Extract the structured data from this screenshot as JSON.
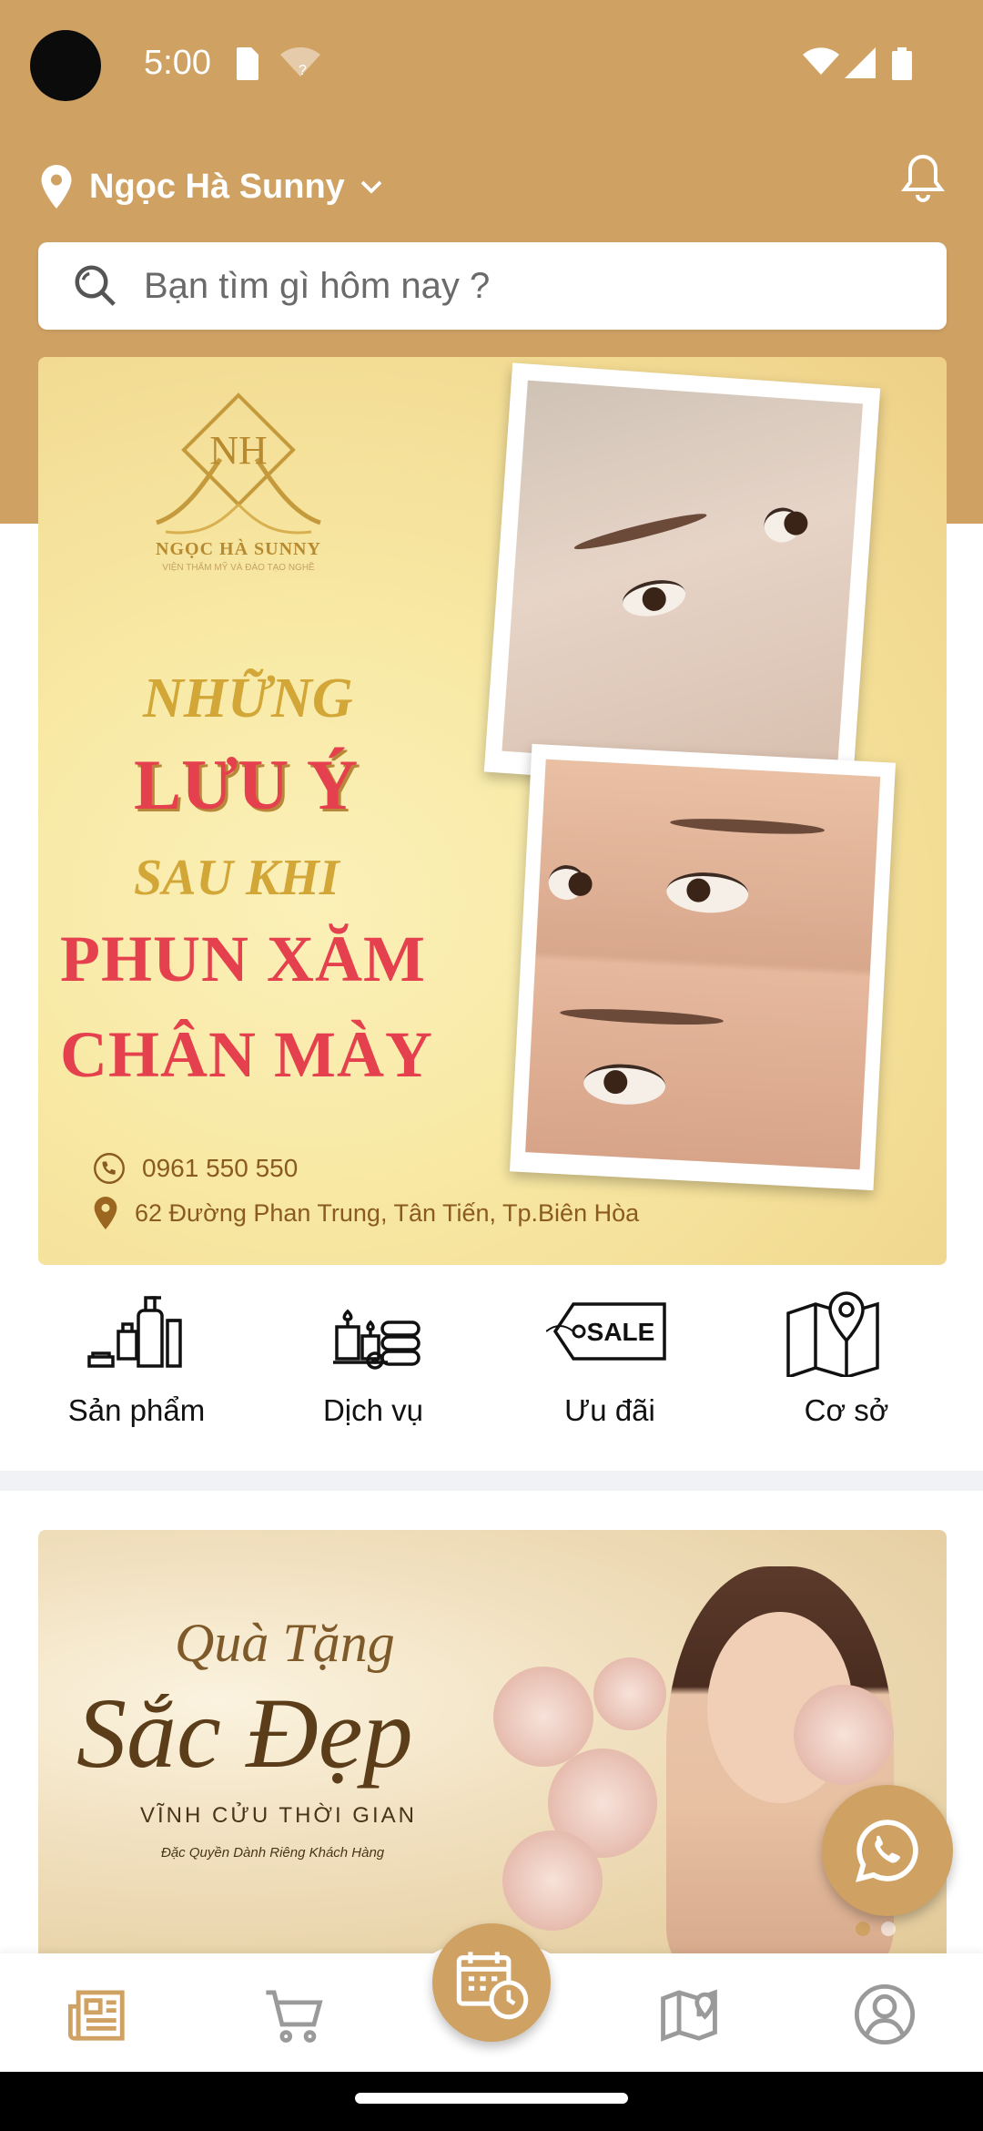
{
  "status": {
    "time": "5:00"
  },
  "header": {
    "location": "Ngọc Hà Sunny"
  },
  "search": {
    "placeholder": "Bạn tìm gì hôm nay ?"
  },
  "banner1": {
    "logo_monogram": "NH",
    "logo_name": "NGỌC HÀ SUNNY",
    "logo_tagline": "VIỆN THẨM MỸ VÀ ĐÀO TẠO NGHỀ",
    "line1": "NHỮNG",
    "line2": "LƯU Ý",
    "line3": "SAU KHI",
    "line4": "PHUN XĂM",
    "line5": "CHÂN MÀY",
    "phone": "0961 550 550",
    "address": "62 Đường Phan Trung, Tân Tiến, Tp.Biên Hòa"
  },
  "categories": [
    {
      "label": "Sản phẩm",
      "icon": "cosmetics-icon"
    },
    {
      "label": "Dịch vụ",
      "icon": "spa-candles-icon"
    },
    {
      "label": "Ưu đãi",
      "icon": "sale-tag-icon"
    },
    {
      "label": "Cơ sở",
      "icon": "map-pin-icon"
    }
  ],
  "sale_tag_text": "SALE",
  "banner2": {
    "line1": "Quà Tặng",
    "line2": "Sắc Đẹp",
    "line3": "VĨNH CỬU THỜI GIAN",
    "line4": "Đặc Quyền Dành Riêng Khách Hàng"
  },
  "bottom_nav": [
    "news-icon",
    "cart-icon",
    "calendar-clock-icon",
    "map-icon",
    "user-icon"
  ],
  "colors": {
    "accent": "#cfa163",
    "banner_red": "#e5404e",
    "banner_gold": "#d3a638"
  }
}
